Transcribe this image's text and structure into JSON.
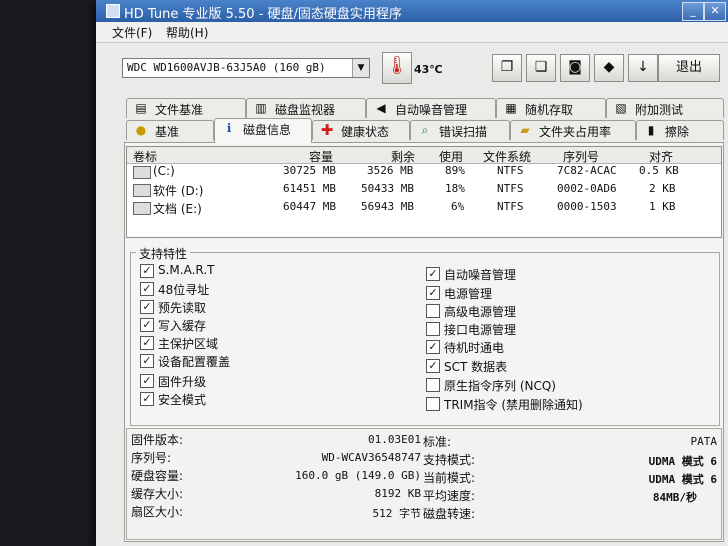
{
  "title": "HD Tune 专业版 5.50 - 硬盘/固态硬盘实用程序",
  "menu": [
    "文件(F)",
    "帮助(H)"
  ],
  "toolbar": {
    "drive": "WDC WD1600AVJB-63J5A0 (160 gB)",
    "temperature": "43℃",
    "exit_label": "退出",
    "buttons": [
      "copy-icon",
      "copy-all-icon",
      "camera-icon",
      "disk-tool-icon",
      "download-icon"
    ]
  },
  "tabs_row1": [
    {
      "label": "文件基准",
      "icon": "file-benchmark-icon"
    },
    {
      "label": "磁盘监视器",
      "icon": "disk-monitor-icon"
    },
    {
      "label": "自动噪音管理",
      "icon": "speaker-icon"
    },
    {
      "label": "随机存取",
      "icon": "random-access-icon"
    },
    {
      "label": "附加测试",
      "icon": "extra-tests-icon"
    }
  ],
  "tabs_row2": [
    {
      "label": "基准",
      "icon": "benchmark-icon"
    },
    {
      "label": "磁盘信息",
      "icon": "info-icon"
    },
    {
      "label": "健康状态",
      "icon": "health-cross-icon"
    },
    {
      "label": "错误扫描",
      "icon": "magnifier-icon"
    },
    {
      "label": "文件夹占用率",
      "icon": "folder-icon"
    },
    {
      "label": "擦除",
      "icon": "trash-icon"
    }
  ],
  "volumes": {
    "headers": [
      "卷标",
      "容量",
      "剩余",
      "使用",
      "文件系统",
      "序列号",
      "对齐"
    ],
    "rows": [
      {
        "name": "(C:)",
        "capacity": "30725 MB",
        "free": "3526 MB",
        "used": "89%",
        "fs": "NTFS",
        "serial": "7C82-ACAC",
        "align": "0.5 KB"
      },
      {
        "name": "软件 (D:)",
        "capacity": "61451 MB",
        "free": "50433 MB",
        "used": "18%",
        "fs": "NTFS",
        "serial": "0002-0AD6",
        "align": "2 KB"
      },
      {
        "name": "文档 (E:)",
        "capacity": "60447 MB",
        "free": "56943 MB",
        "used": "6%",
        "fs": "NTFS",
        "serial": "0000-1503",
        "align": "1 KB"
      }
    ]
  },
  "features": {
    "label": "支持特性",
    "left": [
      {
        "label": "S.M.A.R.T",
        "checked": true
      },
      {
        "label": "48位寻址",
        "checked": true
      },
      {
        "label": "预先读取",
        "checked": true
      },
      {
        "label": "写入缓存",
        "checked": true
      },
      {
        "label": "主保护区域",
        "checked": true
      },
      {
        "label": "设备配置覆盖",
        "checked": true
      },
      {
        "label": "固件升级",
        "checked": true
      },
      {
        "label": "安全模式",
        "checked": true
      }
    ],
    "right": [
      {
        "label": "自动噪音管理",
        "checked": true
      },
      {
        "label": "电源管理",
        "checked": true
      },
      {
        "label": "高级电源管理",
        "checked": false
      },
      {
        "label": "接口电源管理",
        "checked": false
      },
      {
        "label": "待机时通电",
        "checked": true
      },
      {
        "label": "SCT 数据表",
        "checked": true
      },
      {
        "label": "原生指令序列 (NCQ)",
        "checked": false
      },
      {
        "label": "TRIM指令 (禁用删除通知)",
        "checked": false
      }
    ]
  },
  "info": {
    "left": [
      {
        "label": "固件版本:",
        "value": "01.03E01"
      },
      {
        "label": "序列号:",
        "value": "WD-WCAV36548747"
      },
      {
        "label": "硬盘容量:",
        "value": "160.0 gB (149.0 GB)"
      },
      {
        "label": "缓存大小:",
        "value": "8192 KB"
      },
      {
        "label": "扇区大小:",
        "value": "512 字节"
      }
    ],
    "right": [
      {
        "label": "标准:",
        "value": "PATA"
      },
      {
        "label": "支持模式:",
        "value": "UDMA 模式 6"
      },
      {
        "label": "当前模式:",
        "value": "UDMA 模式 6"
      },
      {
        "label": "平均速度:",
        "value": "84MB/秒"
      },
      {
        "label": "磁盘转速:",
        "value": ""
      }
    ]
  }
}
